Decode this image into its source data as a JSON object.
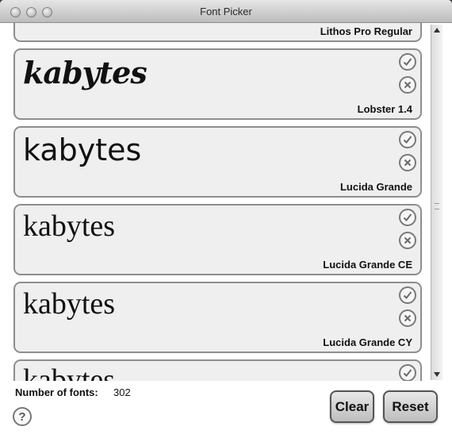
{
  "window": {
    "title": "Font Picker"
  },
  "list": {
    "items": [
      {
        "font_name": "Lithos Pro Regular",
        "sample": "",
        "partial": "top"
      },
      {
        "font_name": "Lobster 1.4",
        "sample": "kabytes"
      },
      {
        "font_name": "Lucida Grande",
        "sample": "kabytes"
      },
      {
        "font_name": "Lucida Grande CE",
        "sample": "kabytes"
      },
      {
        "font_name": "Lucida Grande CY",
        "sample": "kabytes"
      },
      {
        "font_name": "",
        "sample": "kabytes",
        "partial": "bottom"
      }
    ],
    "accept_icon": "checkmark-circle-icon",
    "reject_icon": "x-circle-icon"
  },
  "footer": {
    "count_label": "Number of fonts:",
    "count_value": "302",
    "help_label": "?",
    "clear_label": "Clear",
    "reset_label": "Reset"
  }
}
